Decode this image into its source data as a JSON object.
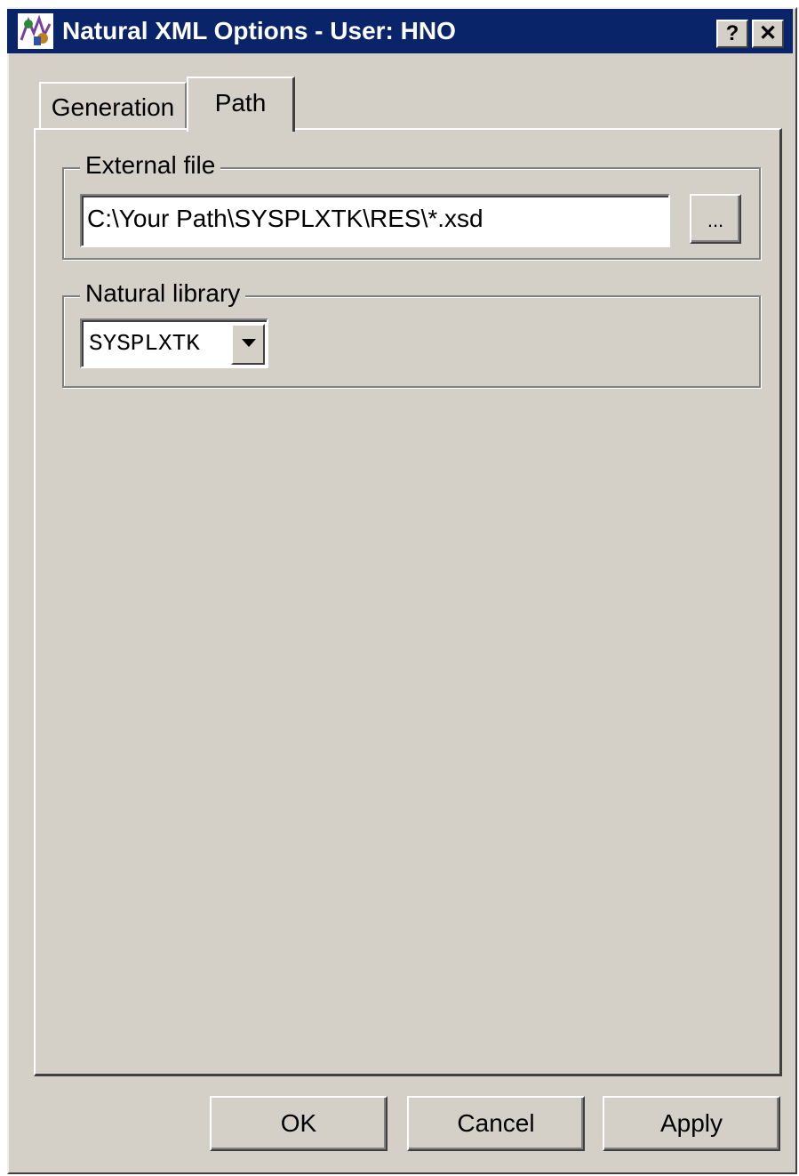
{
  "window": {
    "title": "Natural  XML Options - User: HNO",
    "help_label": "?",
    "close_label": "✕"
  },
  "tabs": [
    {
      "label": "Generation",
      "active": false
    },
    {
      "label": "Path",
      "active": true
    }
  ],
  "external_file": {
    "group_label": "External file",
    "value": "C:\\Your Path\\SYSPLXTK\\RES\\*.xsd",
    "browse_label": "..."
  },
  "natural_library": {
    "group_label": "Natural library",
    "selected": "SYSPLXTK"
  },
  "buttons": {
    "ok": "OK",
    "cancel": "Cancel",
    "apply": "Apply"
  },
  "colors": {
    "titlebar": "#0a246a",
    "face": "#d4d0c8"
  }
}
